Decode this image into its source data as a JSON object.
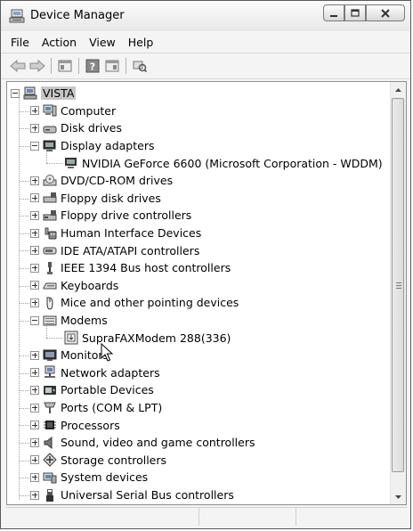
{
  "window": {
    "title": "Device Manager"
  },
  "menu": [
    "File",
    "Action",
    "View",
    "Help"
  ],
  "toolbar": {
    "buttons": [
      "back-icon",
      "forward-icon",
      "properties-icon",
      "help-icon",
      "show-hidden-icon",
      "scan-hardware-icon"
    ]
  },
  "tree": {
    "root": "VISTA",
    "items": [
      {
        "label": "Computer",
        "icon": "computer-icon",
        "expanded": false
      },
      {
        "label": "Disk drives",
        "icon": "disk-drive-icon",
        "expanded": false
      },
      {
        "label": "Display adapters",
        "icon": "display-adapter-icon",
        "expanded": true,
        "children": [
          "NVIDIA GeForce 6600 (Microsoft Corporation - WDDM)"
        ]
      },
      {
        "label": "DVD/CD-ROM drives",
        "icon": "dvd-drive-icon",
        "expanded": false
      },
      {
        "label": "Floppy disk drives",
        "icon": "floppy-disk-icon",
        "expanded": false
      },
      {
        "label": "Floppy drive controllers",
        "icon": "floppy-controller-icon",
        "expanded": false
      },
      {
        "label": "Human Interface Devices",
        "icon": "hid-icon",
        "expanded": false
      },
      {
        "label": "IDE ATA/ATAPI controllers",
        "icon": "ide-controller-icon",
        "expanded": false
      },
      {
        "label": "IEEE 1394 Bus host controllers",
        "icon": "ieee1394-icon",
        "expanded": false
      },
      {
        "label": "Keyboards",
        "icon": "keyboard-icon",
        "expanded": false
      },
      {
        "label": "Mice and other pointing devices",
        "icon": "mouse-icon",
        "expanded": false
      },
      {
        "label": "Modems",
        "icon": "modem-icon",
        "expanded": true,
        "children": [
          "SupraFAXModem 288(336)"
        ]
      },
      {
        "label": "Monitors",
        "icon": "monitor-icon",
        "expanded": false
      },
      {
        "label": "Network adapters",
        "icon": "network-adapter-icon",
        "expanded": false
      },
      {
        "label": "Portable Devices",
        "icon": "portable-device-icon",
        "expanded": false
      },
      {
        "label": "Ports (COM & LPT)",
        "icon": "port-icon",
        "expanded": false
      },
      {
        "label": "Processors",
        "icon": "processor-icon",
        "expanded": false
      },
      {
        "label": "Sound, video and game controllers",
        "icon": "sound-icon",
        "expanded": false
      },
      {
        "label": "Storage controllers",
        "icon": "storage-controller-icon",
        "expanded": false
      },
      {
        "label": "System devices",
        "icon": "system-devices-icon",
        "expanded": false
      },
      {
        "label": "Universal Serial Bus controllers",
        "icon": "usb-icon",
        "expanded": false
      }
    ]
  }
}
